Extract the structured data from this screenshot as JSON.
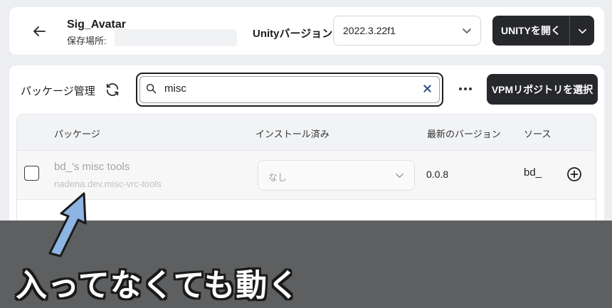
{
  "header": {
    "project_name": "Sig_Avatar",
    "location_label": "保存場所:",
    "unity_version_label": "Unityバージョン:",
    "unity_version_value": "2022.3.22f1",
    "open_unity_label": "UNITYを開く"
  },
  "package_manager": {
    "title": "パッケージ管理",
    "search_value": "misc",
    "vpm_button_label": "VPMリポジトリを選択",
    "columns": {
      "package": "パッケージ",
      "installed": "インストール済み",
      "latest": "最新のバージョン",
      "source": "ソース"
    },
    "rows": [
      {
        "name": "bd_'s misc tools",
        "id": "nadena.dev.misc-vrc-tools",
        "installed": "なし",
        "latest": "0.0.8",
        "source": "bd_"
      }
    ]
  },
  "annotation": {
    "caption": "入ってなくても動く",
    "arrow_color": "#8db4e2"
  },
  "icons": [
    "back-arrow-icon",
    "chevron-down-icon",
    "refresh-icon",
    "search-icon",
    "close-icon",
    "more-horizontal-icon",
    "add-circle-icon"
  ]
}
